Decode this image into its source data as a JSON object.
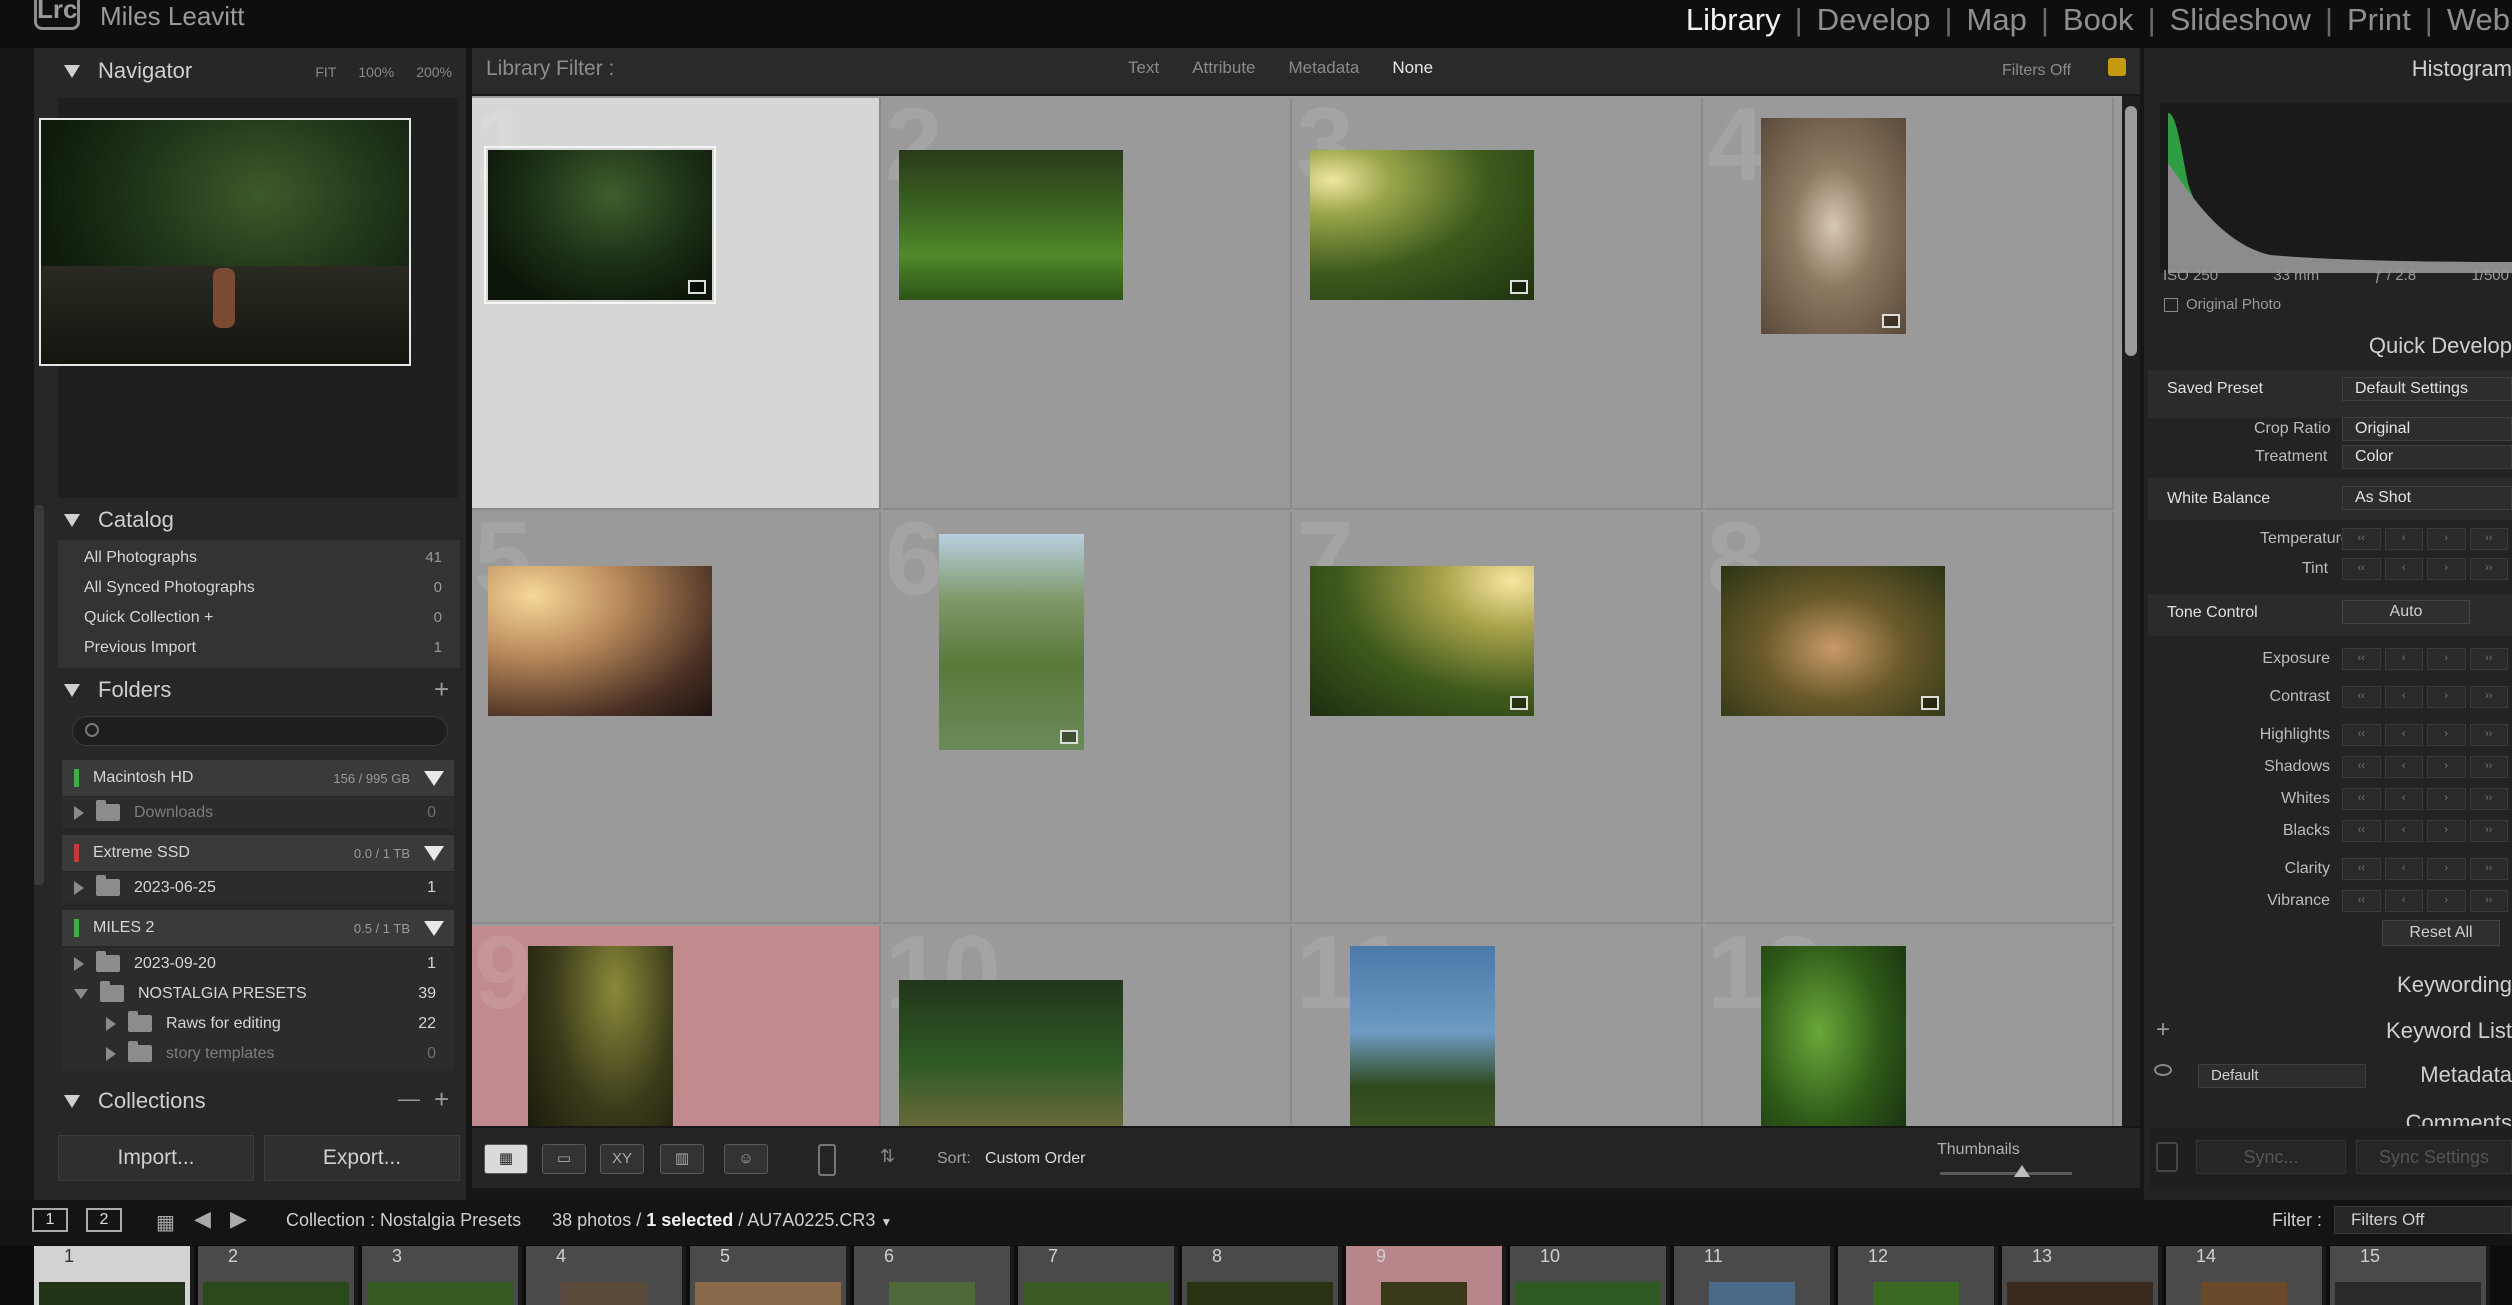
{
  "app": {
    "logo": "Lrc",
    "owner": "Miles Leavitt",
    "modules": [
      "Library",
      "Develop",
      "Map",
      "Book",
      "Slideshow",
      "Print",
      "Web"
    ],
    "active_module": "Library"
  },
  "navigator": {
    "title": "Navigator",
    "zoom_fit": "FIT",
    "zoom_100": "100%",
    "zoom_200": "200%"
  },
  "catalog": {
    "title": "Catalog",
    "items": [
      {
        "label": "All Photographs",
        "count": "41"
      },
      {
        "label": "All Synced Photographs",
        "count": "0"
      },
      {
        "label": "Quick Collection +",
        "count": "0"
      },
      {
        "label": "Previous Import",
        "count": "1"
      }
    ]
  },
  "folders": {
    "title": "Folders",
    "add": "+",
    "drives": [
      {
        "name": "Macintosh HD",
        "capacity": "156 / 995 GB",
        "led": "#3fae49",
        "folders": [
          {
            "name": "Downloads",
            "count": "0",
            "dim": true
          }
        ]
      },
      {
        "name": "Extreme SSD",
        "capacity": "0.0 / 1 TB",
        "led": "#c23a3a",
        "folders": [
          {
            "name": "2023-06-25",
            "count": "1"
          }
        ]
      },
      {
        "name": "MILES 2",
        "capacity": "0.5 / 1 TB",
        "led": "#3fae49",
        "folders": [
          {
            "name": "2023-09-20",
            "count": "1"
          },
          {
            "name": "NOSTALGIA PRESETS",
            "count": "39",
            "expanded": true
          },
          {
            "name": "Raws for editing",
            "count": "22",
            "sub": true
          },
          {
            "name": "story templates",
            "count": "0",
            "sub": true,
            "dim": true
          }
        ]
      }
    ]
  },
  "collections": {
    "title": "Collections",
    "minus": "—",
    "plus": "+"
  },
  "left_buttons": {
    "import": "Import...",
    "export": "Export..."
  },
  "library_filter": {
    "label": "Library Filter :",
    "options": [
      "Text",
      "Attribute",
      "Metadata",
      "None"
    ],
    "active": "None",
    "status": "Filters Off"
  },
  "grid": {
    "cells": [
      {
        "num": "1",
        "state": "selected",
        "badge": true
      },
      {
        "num": "2",
        "state": "normal",
        "badge": false
      },
      {
        "num": "3",
        "state": "normal",
        "badge": true
      },
      {
        "num": "4",
        "state": "normal",
        "badge": true
      },
      {
        "num": "5",
        "state": "normal",
        "badge": false
      },
      {
        "num": "6",
        "state": "normal",
        "badge": true
      },
      {
        "num": "7",
        "state": "normal",
        "badge": true
      },
      {
        "num": "8",
        "state": "normal",
        "badge": true
      },
      {
        "num": "9",
        "state": "red",
        "badge": false
      },
      {
        "num": "10",
        "state": "normal",
        "badge": false
      },
      {
        "num": "11",
        "state": "normal",
        "badge": false
      },
      {
        "num": "12",
        "state": "normal",
        "badge": false
      }
    ]
  },
  "toolbar": {
    "sort_label": "Sort:",
    "sort_value": "Custom Order",
    "thumbnails_label": "Thumbnails",
    "thumbnail_size": 0.6
  },
  "histogram": {
    "title": "Histogram",
    "iso": "ISO 250",
    "focal": "33 mm",
    "aperture": "ƒ / 2.8",
    "shutter": "1/500",
    "original_photo": "Original Photo"
  },
  "quick_develop": {
    "title": "Quick Develop",
    "saved_preset_label": "Saved Preset",
    "saved_preset_value": "Default Settings",
    "crop_ratio_label": "Crop Ratio",
    "crop_ratio_value": "Original",
    "treatment_label": "Treatment",
    "treatment_value": "Color",
    "white_balance_label": "White Balance",
    "white_balance_value": "As Shot",
    "temperature_label": "Temperature",
    "tint_label": "Tint",
    "tone_control_label": "Tone Control",
    "auto_label": "Auto",
    "tone_rows": [
      "Exposure",
      "Contrast",
      "Highlights",
      "Shadows",
      "Whites",
      "Blacks",
      "Clarity",
      "Vibrance"
    ],
    "reset_all": "Reset All"
  },
  "right_sections": {
    "keywording": "Keywording",
    "keyword_list": "Keyword List",
    "metadata": "Metadata",
    "metadata_preset": "Default",
    "comments": "Comments",
    "sync": "Sync...",
    "sync_settings": "Sync Settings"
  },
  "bottom_bar": {
    "page1": "1",
    "page2": "2",
    "collection": "Collection : Nostalgia Presets",
    "photo_count": "38 photos /",
    "selected": "1 selected",
    "filename": "/ AU7A0225.CR3",
    "filter_label": "Filter :",
    "filter_value": "Filters Off"
  },
  "filmstrip": {
    "numbers": [
      "1",
      "2",
      "3",
      "4",
      "5",
      "6",
      "7",
      "8",
      "9",
      "10",
      "11",
      "12",
      "13",
      "14",
      "15"
    ]
  },
  "colors": {
    "accent_active": "#f2f2f2",
    "selection": "#d6d6d6",
    "red_label": "#c08a8f",
    "lock": "#c59a10",
    "histogram_green": "#2f9e43"
  }
}
